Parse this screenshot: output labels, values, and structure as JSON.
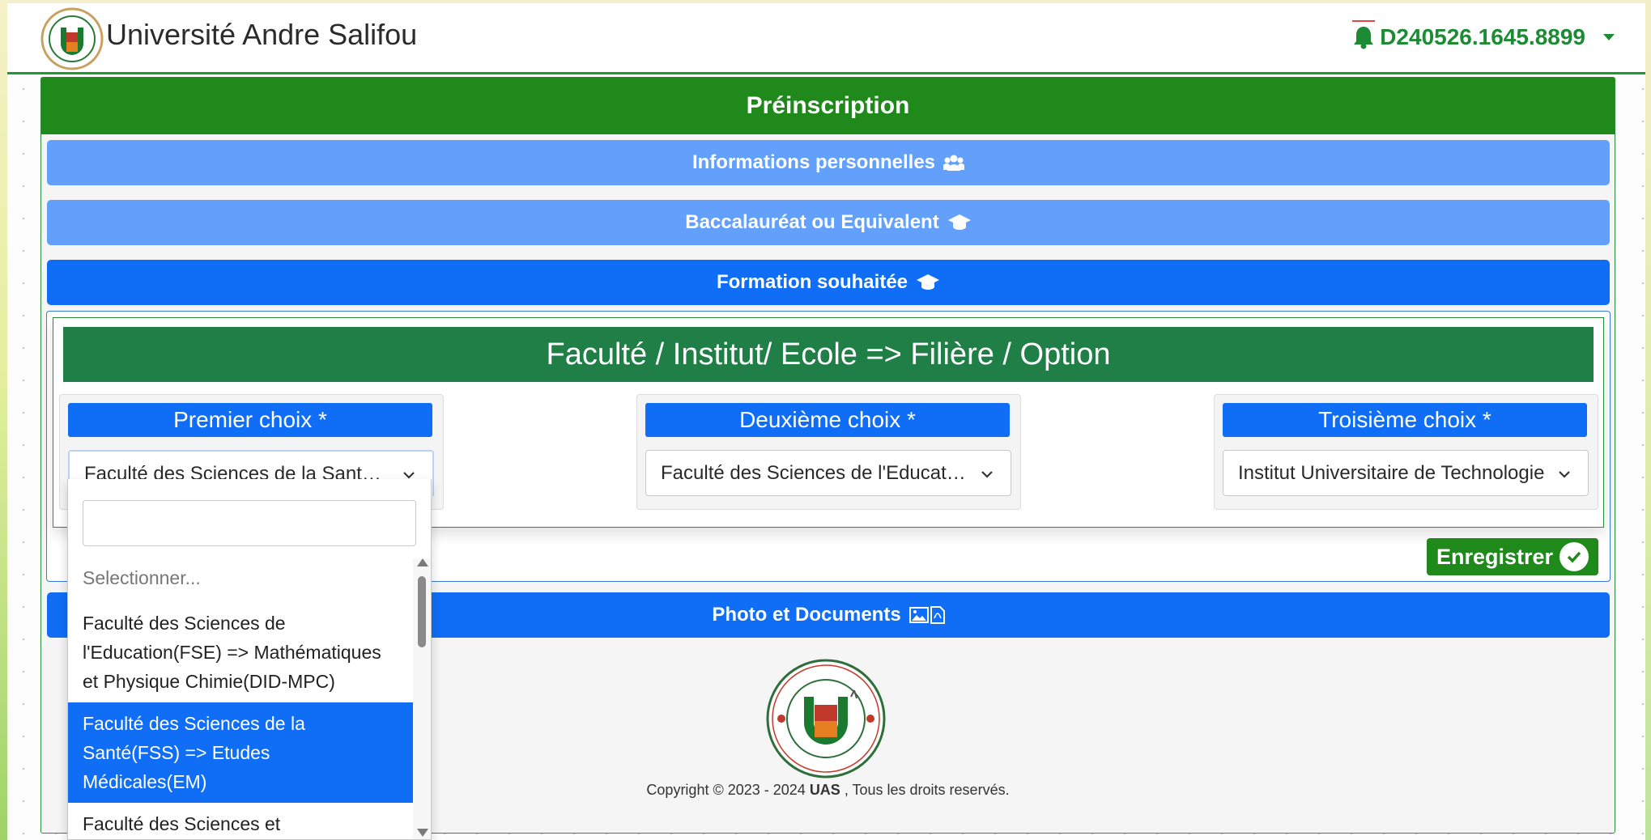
{
  "header": {
    "brand": "Université Andre Salifou",
    "user_id": "D240526.1645.8899",
    "logo_icon": "university-logo-icon"
  },
  "page": {
    "title": "Préinscription",
    "sections": {
      "personal": "Informations personnelles",
      "bac": "Baccalauréat ou Equivalent",
      "formation": "Formation souhaitée",
      "documents": "Photo et Documents"
    },
    "faculty_title": "Faculté / Institut/ Ecole => Filière / Option",
    "choices": [
      {
        "label": "Premier choix *",
        "value": "Faculté des Sciences de la Santé(FSS) => Etudes Médicales(EM)"
      },
      {
        "label": "Deuxième choix *",
        "value": "Faculté des Sciences de l'Education(FSE) => Mathématiques et Physique Chimie(DID-MPC)"
      },
      {
        "label": "Troisième choix *",
        "value": "Institut Universitaire de Technologie"
      }
    ],
    "save_label": "Enregistrer"
  },
  "dropdown": {
    "search_value": "",
    "placeholder": "Selectionner...",
    "options": [
      "Faculté des Sciences de l'Education(FSE) => Mathématiques et Physique Chimie(DID-MPC)",
      "Faculté des Sciences de la Santé(FSS) => Etudes Médicales(EM)",
      "Faculté des Sciences et"
    ],
    "selected_index": 1
  },
  "footer": {
    "copyright_prefix": "Copyright © 2023 - 2024 ",
    "copyright_org": "UAS",
    "copyright_suffix": " , Tous les droits reservés."
  },
  "colors": {
    "green_header": "#1f891b",
    "faculty_green": "#1f7f46",
    "blue_primary": "#0f6ef5",
    "blue_light": "#62a0fb",
    "brand_text": "#2b2b2b",
    "user_green": "#1d8b33"
  }
}
